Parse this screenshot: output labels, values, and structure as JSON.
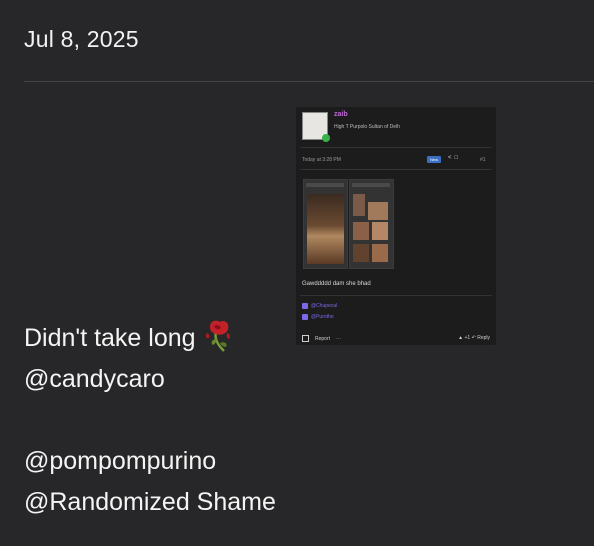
{
  "post": {
    "date": "Jul 8, 2025",
    "lines": [
      "Didn't take long",
      "@candycaro",
      "",
      "@pompompurino",
      "@Randomized Shame"
    ],
    "emoji": "wilted-rose-emoji"
  },
  "embed": {
    "username": "zaib",
    "user_title": "High T Purpolo Sultan of Delh",
    "timestamp": "Today at 3:28 PM",
    "new_badge": "New",
    "post_number": "#1",
    "body_text": "Gawddddd dam she bhad",
    "mentions": [
      "@Chupecal",
      "@Purotho"
    ],
    "report": "Report",
    "reactions": "+1",
    "reply": "Reply"
  }
}
